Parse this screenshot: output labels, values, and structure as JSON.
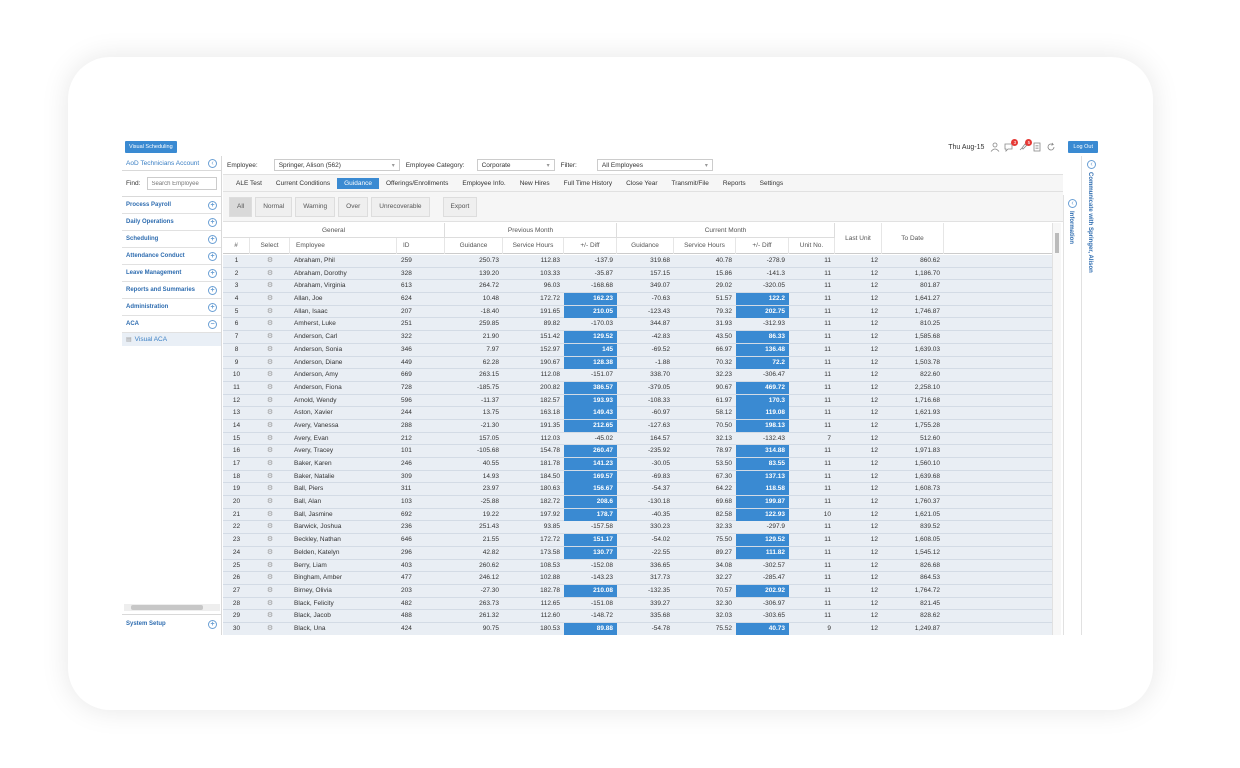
{
  "topbar": {
    "visual_scheduling": "Visual Scheduling",
    "date": "Thu Aug-15",
    "badge1": "3",
    "badge2": "5",
    "logout": "Log Out"
  },
  "sidebar": {
    "account": "AoD Technicians Account",
    "find_label": "Find:",
    "search_placeholder": "Search Employee",
    "items": [
      {
        "label": "Process Payroll"
      },
      {
        "label": "Daily Operations"
      },
      {
        "label": "Scheduling"
      },
      {
        "label": "Attendance Conduct"
      },
      {
        "label": "Leave Management"
      },
      {
        "label": "Reports and Summaries"
      },
      {
        "label": "Administration"
      },
      {
        "label": "ACA"
      }
    ],
    "sub_item": "Visual ACA",
    "system_setup": "System Setup"
  },
  "filters": {
    "employee_label": "Employee:",
    "employee_value": "Springer, Alison  (562)",
    "category_label": "Employee Category:",
    "category_value": "Corporate",
    "filter_label": "Filter:",
    "filter_value": "All Employees"
  },
  "tabs": [
    "ALE Test",
    "Current Conditions",
    "Guidance",
    "Offerings/Enrollments",
    "Employee Info.",
    "New Hires",
    "Full Time History",
    "Close Year",
    "Transmit/File",
    "Reports",
    "Settings"
  ],
  "buttons": {
    "all": "All",
    "normal": "Normal",
    "warning": "Warning",
    "over": "Over",
    "unrecoverable": "Unrecoverable",
    "export": "Export"
  },
  "grid": {
    "groups": {
      "general": "General",
      "previous": "Previous Month",
      "current": "Current Month"
    },
    "columns": {
      "num": "#",
      "select": "Select",
      "employee": "Employee",
      "id": "ID",
      "guidance": "Guidance",
      "service_hours": "Service Hours",
      "diff": "+/- Diff",
      "unit_no": "Unit No.",
      "last_unit": "Last Unit",
      "to_date": "To Date"
    },
    "rows": [
      [
        "1",
        "Abraham, Phil",
        "259",
        "250.73",
        "112.83",
        "-137.9",
        "319.68",
        "40.78",
        "-278.9",
        "11",
        "12",
        "860.62"
      ],
      [
        "2",
        "Abraham, Dorothy",
        "328",
        "139.20",
        "103.33",
        "-35.87",
        "157.15",
        "15.86",
        "-141.3",
        "11",
        "12",
        "1,186.70"
      ],
      [
        "3",
        "Abraham, Virginia",
        "613",
        "264.72",
        "96.03",
        "-168.68",
        "349.07",
        "29.02",
        "-320.05",
        "11",
        "12",
        "801.87"
      ],
      [
        "4",
        "Allan, Joe",
        "624",
        "10.48",
        "172.72",
        "162.23",
        "-70.63",
        "51.57",
        "122.2",
        "11",
        "12",
        "1,641.27"
      ],
      [
        "5",
        "Allan, Isaac",
        "207",
        "-18.40",
        "191.65",
        "210.05",
        "-123.43",
        "79.32",
        "202.75",
        "11",
        "12",
        "1,746.87"
      ],
      [
        "6",
        "Amherst, Luke",
        "251",
        "259.85",
        "89.82",
        "-170.03",
        "344.87",
        "31.93",
        "-312.93",
        "11",
        "12",
        "810.25"
      ],
      [
        "7",
        "Anderson, Carl",
        "322",
        "21.90",
        "151.42",
        "129.52",
        "-42.83",
        "43.50",
        "86.33",
        "11",
        "12",
        "1,585.68"
      ],
      [
        "8",
        "Anderson, Sonia",
        "346",
        "7.97",
        "152.97",
        "145",
        "-69.52",
        "66.97",
        "136.48",
        "11",
        "12",
        "1,639.03"
      ],
      [
        "9",
        "Anderson, Diane",
        "449",
        "62.28",
        "190.67",
        "128.38",
        "-1.88",
        "70.32",
        "72.2",
        "11",
        "12",
        "1,503.78"
      ],
      [
        "10",
        "Anderson, Amy",
        "669",
        "263.15",
        "112.08",
        "-151.07",
        "338.70",
        "32.23",
        "-306.47",
        "11",
        "12",
        "822.60"
      ],
      [
        "11",
        "Anderson, Fiona",
        "728",
        "-185.75",
        "200.82",
        "386.57",
        "-379.05",
        "90.67",
        "469.72",
        "11",
        "12",
        "2,258.10"
      ],
      [
        "12",
        "Arnold, Wendy",
        "596",
        "-11.37",
        "182.57",
        "193.93",
        "-108.33",
        "61.97",
        "170.3",
        "11",
        "12",
        "1,716.68"
      ],
      [
        "13",
        "Aston, Xavier",
        "244",
        "13.75",
        "163.18",
        "149.43",
        "-60.97",
        "58.12",
        "119.08",
        "11",
        "12",
        "1,621.93"
      ],
      [
        "14",
        "Avery, Vanessa",
        "288",
        "-21.30",
        "191.35",
        "212.65",
        "-127.63",
        "70.50",
        "198.13",
        "11",
        "12",
        "1,755.28"
      ],
      [
        "15",
        "Avery, Evan",
        "212",
        "157.05",
        "112.03",
        "-45.02",
        "164.57",
        "32.13",
        "-132.43",
        "7",
        "12",
        "512.60"
      ],
      [
        "16",
        "Avery, Tracey",
        "101",
        "-105.68",
        "154.78",
        "260.47",
        "-235.92",
        "78.97",
        "314.88",
        "11",
        "12",
        "1,971.83"
      ],
      [
        "17",
        "Baker, Karen",
        "246",
        "40.55",
        "181.78",
        "141.23",
        "-30.05",
        "53.50",
        "83.55",
        "11",
        "12",
        "1,560.10"
      ],
      [
        "18",
        "Baker, Natalie",
        "309",
        "14.93",
        "184.50",
        "169.57",
        "-69.83",
        "67.30",
        "137.13",
        "11",
        "12",
        "1,639.68"
      ],
      [
        "19",
        "Ball, Piers",
        "311",
        "23.97",
        "180.63",
        "156.67",
        "-54.37",
        "64.22",
        "118.58",
        "11",
        "12",
        "1,608.73"
      ],
      [
        "20",
        "Ball, Alan",
        "103",
        "-25.88",
        "182.72",
        "208.6",
        "-130.18",
        "69.68",
        "199.87",
        "11",
        "12",
        "1,760.37"
      ],
      [
        "21",
        "Ball, Jasmine",
        "692",
        "19.22",
        "197.92",
        "178.7",
        "-40.35",
        "82.58",
        "122.93",
        "10",
        "12",
        "1,621.05"
      ],
      [
        "22",
        "Barwick, Joshua",
        "236",
        "251.43",
        "93.85",
        "-157.58",
        "330.23",
        "32.33",
        "-297.9",
        "11",
        "12",
        "839.52"
      ],
      [
        "23",
        "Beckley, Nathan",
        "646",
        "21.55",
        "172.72",
        "151.17",
        "-54.02",
        "75.50",
        "129.52",
        "11",
        "12",
        "1,608.05"
      ],
      [
        "24",
        "Belden, Katelyn",
        "296",
        "42.82",
        "173.58",
        "130.77",
        "-22.55",
        "89.27",
        "111.82",
        "11",
        "12",
        "1,545.12"
      ],
      [
        "25",
        "Berry, Liam",
        "403",
        "260.62",
        "108.53",
        "-152.08",
        "336.65",
        "34.08",
        "-302.57",
        "11",
        "12",
        "826.68"
      ],
      [
        "26",
        "Bingham, Amber",
        "477",
        "246.12",
        "102.88",
        "-143.23",
        "317.73",
        "32.27",
        "-285.47",
        "11",
        "12",
        "864.53"
      ],
      [
        "27",
        "Birney, Olivia",
        "203",
        "-27.30",
        "182.78",
        "210.08",
        "-132.35",
        "70.57",
        "202.92",
        "11",
        "12",
        "1,764.72"
      ],
      [
        "28",
        "Black, Felicity",
        "482",
        "263.73",
        "112.65",
        "-151.08",
        "339.27",
        "32.30",
        "-306.97",
        "11",
        "12",
        "821.45"
      ],
      [
        "29",
        "Black, Jacob",
        "488",
        "261.32",
        "112.60",
        "-148.72",
        "335.68",
        "32.03",
        "-303.65",
        "11",
        "12",
        "828.62"
      ],
      [
        "30",
        "Black, Una",
        "424",
        "90.75",
        "180.53",
        "89.88",
        "-54.78",
        "75.52",
        "40.73",
        "9",
        "12",
        "1,249.87"
      ]
    ]
  },
  "right_panel": {
    "information": "Information",
    "communicate": "Communicate with Springer, Alison"
  }
}
